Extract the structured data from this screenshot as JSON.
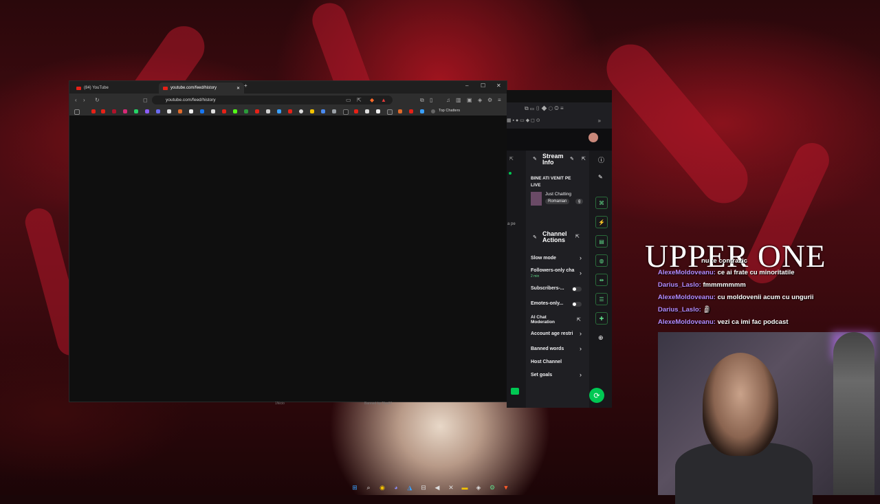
{
  "browser": {
    "tabs": [
      {
        "label": "(84) YouTube",
        "active": false
      },
      {
        "label": "youtube.com/feed/history",
        "active": true
      }
    ],
    "new_tab": "+",
    "controls": {
      "minimize": "–",
      "maximize": "☐",
      "close": "✕"
    },
    "url": "youtube.com/feed/history",
    "bookmark_label": "Top Chatters"
  },
  "stream_info": {
    "header": "Stream Info",
    "title": "BINE ATI VENIT PE LIVE",
    "category": "Just Chatting",
    "tags": [
      "Romanian",
      "g"
    ]
  },
  "channel_actions": {
    "header": "Channel Actions",
    "items": [
      {
        "label": "Slow mode",
        "control": "chevron"
      },
      {
        "label": "Followers-only cha",
        "sub": "2 min",
        "control": "chevron"
      },
      {
        "label": "Subscribers-...",
        "control": "toggle"
      },
      {
        "label": "Emotes-only...",
        "control": "toggle"
      },
      {
        "label": "AI Chat Moderation",
        "control": "external"
      },
      {
        "label": "Account age restri",
        "control": "chevron"
      },
      {
        "label": "Banned words",
        "control": "chevron"
      },
      {
        "label": "Host Channel",
        "control": "none"
      },
      {
        "label": "Set goals",
        "control": "chevron"
      }
    ]
  },
  "left_panel": {
    "fragment": "a pe"
  },
  "overlay": {
    "title": "UPPER ONE",
    "chat": [
      {
        "user": "",
        "text": "nu te contrazic"
      },
      {
        "user": "AlexeMoldoveanu:",
        "text": "ce ai frate cu minoritatile"
      },
      {
        "user": "Darius_Laslo:",
        "text": "fmmmmmmm"
      },
      {
        "user": "AlexeMoldoveanu:",
        "text": "cu moldovenii acum cu ungurii"
      },
      {
        "user": "Darius_Laslo:",
        "text": "🗿"
      },
      {
        "user": "AlexeMoldoveanu:",
        "text": "vezi ca imi fac podcast"
      }
    ]
  },
  "footer": {
    "left": "1Nicio",
    "mid": "Banned by Tiba07"
  },
  "colors": {
    "accent_green": "#00c853",
    "twitch_purple": "#b48cff",
    "youtube_red": "#e62117"
  }
}
